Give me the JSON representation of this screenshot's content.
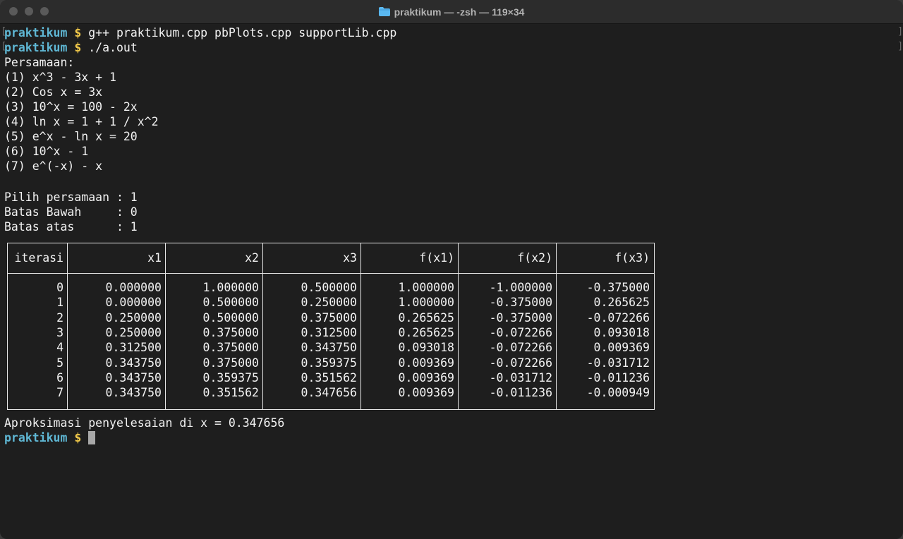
{
  "window": {
    "title": "praktikum — -zsh — 119×34",
    "folder_icon_color": "#5ab8f0"
  },
  "terminal": {
    "prompt": {
      "name": "praktikum",
      "symbol": "$"
    },
    "commands": [
      "g++ praktikum.cpp pbPlots.cpp supportLib.cpp",
      "./a.out"
    ],
    "menu_header": "Persamaan:",
    "equations": [
      "(1) x^3 - 3x + 1",
      "(2) Cos x = 3x",
      "(3) 10^x = 100 - 2x",
      "(4) ln x = 1 + 1 / x^2",
      "(5) e^x - ln x = 20",
      "(6) 10^x - 1",
      "(7) e^(-x) - x"
    ],
    "inputs": [
      "Pilih persamaan : 1",
      "Batas Bawah     : 0",
      "Batas atas      : 1"
    ],
    "table": {
      "headers": [
        "iterasi",
        "x1",
        "x2",
        "x3",
        "f(x1)",
        "f(x2)",
        "f(x3)"
      ],
      "rows": [
        [
          "0",
          "0.000000",
          "1.000000",
          "0.500000",
          "1.000000",
          "-1.000000",
          "-0.375000"
        ],
        [
          "1",
          "0.000000",
          "0.500000",
          "0.250000",
          "1.000000",
          "-0.375000",
          "0.265625"
        ],
        [
          "2",
          "0.250000",
          "0.500000",
          "0.375000",
          "0.265625",
          "-0.375000",
          "-0.072266"
        ],
        [
          "3",
          "0.250000",
          "0.375000",
          "0.312500",
          "0.265625",
          "-0.072266",
          "0.093018"
        ],
        [
          "4",
          "0.312500",
          "0.375000",
          "0.343750",
          "0.093018",
          "-0.072266",
          "0.009369"
        ],
        [
          "5",
          "0.343750",
          "0.375000",
          "0.359375",
          "0.009369",
          "-0.072266",
          "-0.031712"
        ],
        [
          "6",
          "0.343750",
          "0.359375",
          "0.351562",
          "0.009369",
          "-0.031712",
          "-0.011236"
        ],
        [
          "7",
          "0.343750",
          "0.351562",
          "0.347656",
          "0.009369",
          "-0.011236",
          "-0.000949"
        ]
      ]
    },
    "result": "Aproksimasi penyelesaian di x = 0.347656"
  }
}
